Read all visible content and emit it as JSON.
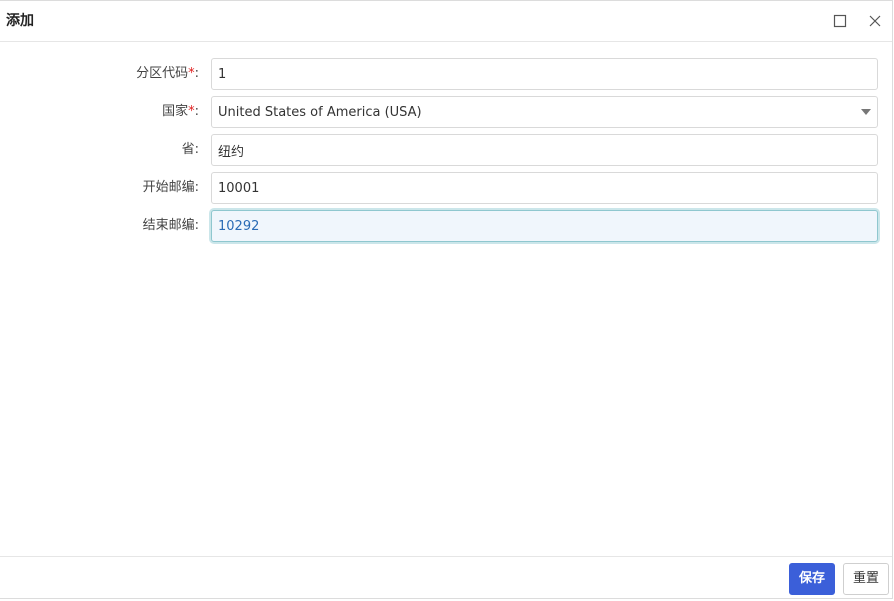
{
  "dialog": {
    "title": "添加"
  },
  "form": {
    "partition_code": {
      "label": "分区代码",
      "required_mark": "*",
      "colon": ":",
      "value": "1"
    },
    "country": {
      "label": "国家",
      "required_mark": "*",
      "colon": ":",
      "selected": "United States of America (USA)"
    },
    "province": {
      "label": "省",
      "colon": ":",
      "value": "纽约"
    },
    "start_zip": {
      "label": "开始邮编",
      "colon": ":",
      "value": "10001"
    },
    "end_zip": {
      "label": "结束邮编",
      "colon": ":",
      "value": "10292"
    }
  },
  "footer": {
    "save_label": "保存",
    "reset_label": "重置"
  },
  "icons": {
    "maximize": "maximize-icon",
    "close": "close-icon",
    "dropdown": "chevron-down-icon"
  },
  "colors": {
    "primary": "#3b5fd9",
    "required": "#e02020",
    "focus_border": "#8fc7cf",
    "focus_bg": "#f0f6fc"
  }
}
